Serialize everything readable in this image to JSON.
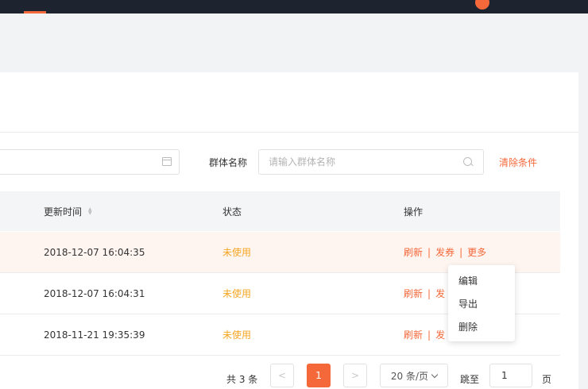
{
  "colors": {
    "accent": "#f4683a",
    "status_unused": "#f5a623",
    "topbar": "#1e2330"
  },
  "filter": {
    "date_icon": "calendar-icon",
    "group_label": "群体名称",
    "group_placeholder": "请输入群体名称",
    "search_icon": "search-icon",
    "clear_label": "清除条件"
  },
  "table": {
    "headers": {
      "update_time": "更新时间",
      "status": "状态",
      "actions": "操作"
    },
    "rows": [
      {
        "update_time": "2018-12-07 16:04:35",
        "status": "未使用",
        "refresh": "刷新",
        "issue": "发券",
        "more": "更多",
        "highlighted": true
      },
      {
        "update_time": "2018-12-07 16:04:31",
        "status": "未使用",
        "refresh": "刷新",
        "issue": "发"
      },
      {
        "update_time": "2018-11-21 19:35:39",
        "status": "未使用",
        "refresh": "刷新",
        "issue": "发"
      }
    ]
  },
  "more_menu": {
    "items": [
      "编辑",
      "导出",
      "删除"
    ]
  },
  "pagination": {
    "total": "共 3 条",
    "prev": "<",
    "current": "1",
    "next": ">",
    "page_size": "20 条/页",
    "jump_label": "跳至",
    "jump_value": "1",
    "page_unit": "页"
  }
}
